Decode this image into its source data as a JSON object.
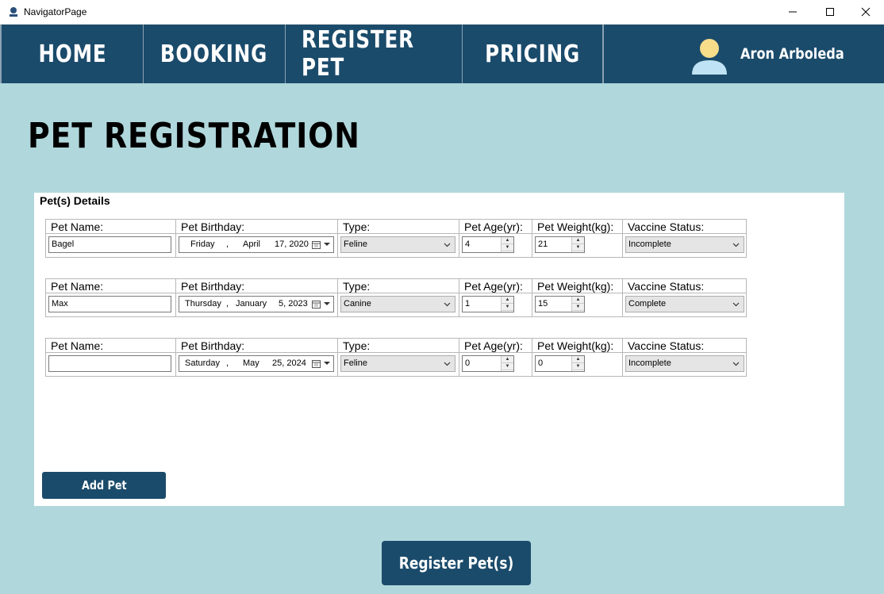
{
  "window": {
    "title": "NavigatorPage"
  },
  "nav": {
    "items": [
      {
        "label": "HOME"
      },
      {
        "label": "BOOKING"
      },
      {
        "label": "REGISTER PET"
      },
      {
        "label": "PRICING"
      }
    ],
    "user_name": "Aron Arboleda"
  },
  "page": {
    "title": "PET REGISTRATION"
  },
  "panel": {
    "title": "Pet(s) Details"
  },
  "columns": {
    "name": "Pet Name:",
    "birthday": "Pet Birthday:",
    "type": "Type:",
    "age": "Pet Age(yr):",
    "weight": "Pet Weight(kg):",
    "vaccine": "Vaccine Status:"
  },
  "pets": [
    {
      "name": "Bagel",
      "bday_day": "Friday",
      "bday_month": "April",
      "bday_date": "17, 2020",
      "type": "Feline",
      "age": "4",
      "weight": "21",
      "vaccine": "Incomplete"
    },
    {
      "name": "Max",
      "bday_day": "Thursday",
      "bday_month": "January",
      "bday_date": "5, 2023",
      "type": "Canine",
      "age": "1",
      "weight": "15",
      "vaccine": "Complete"
    },
    {
      "name": "",
      "bday_day": "Saturday",
      "bday_month": "May",
      "bday_date": "25, 2024",
      "type": "Feline",
      "age": "0",
      "weight": "0",
      "vaccine": "Incomplete"
    }
  ],
  "buttons": {
    "add_pet": "Add Pet",
    "register": "Register Pet(s)"
  },
  "colors": {
    "nav_bg": "#1b4b6b",
    "page_bg": "#b0d8dc",
    "button_bg": "#1b4b6b"
  }
}
